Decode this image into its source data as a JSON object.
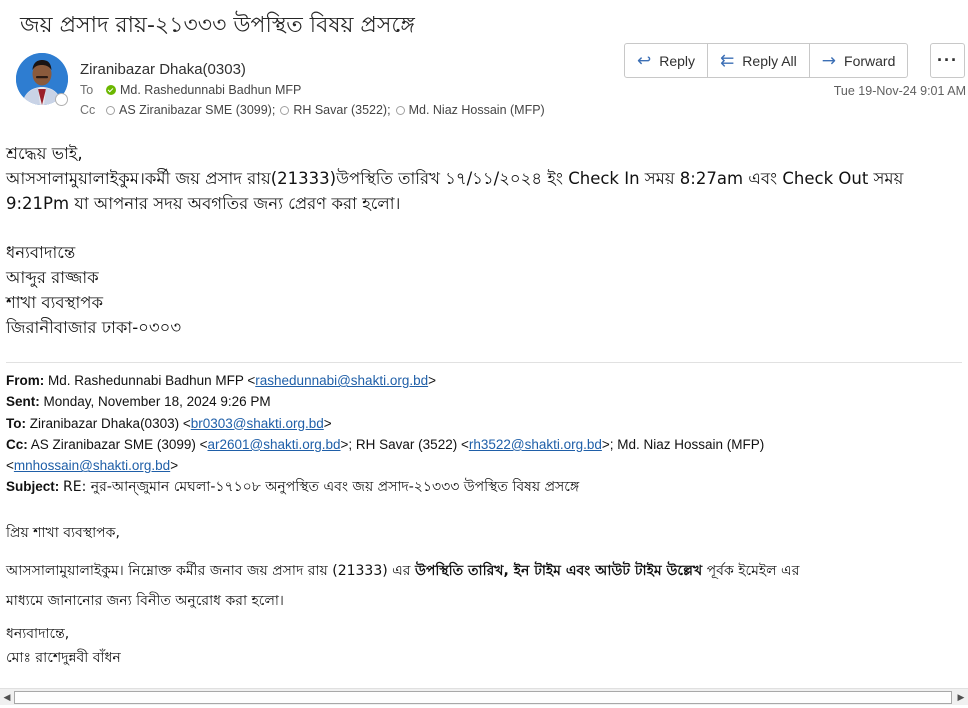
{
  "subject": "জয় প্রসাদ রায়-২১৩৩৩ উপস্থিত বিষয় প্রসঙ্গে",
  "header": {
    "sender": "Ziranibazar Dhaka(0303)",
    "to_label": "To",
    "to": "Md. Rashedunnabi Badhun MFP",
    "cc_label": "Cc",
    "cc": [
      "AS Ziranibazar SME (3099);",
      "RH Savar (3522);",
      "Md. Niaz Hossain (MFP)"
    ],
    "date": "Tue 19-Nov-24 9:01 AM"
  },
  "actions": {
    "reply": "Reply",
    "reply_all": "Reply All",
    "forward": "Forward",
    "more": "···"
  },
  "body": {
    "greeting": "শ্রদ্ধেয় ভাই,",
    "line1": "আসসালামুয়ালাইকুম।কর্মী জয় প্রসাদ রায়(21333)উপস্থিতি তারিখ ১৭/১১/২০২৪ ইং  Check In সময় 8:27am এবং Check Out সময়",
    "line2": "9:21Pm যা আপনার সদয় অবগতির জন্য প্রেরণ করা হলো।",
    "closing": "ধন্যবাদান্তে",
    "name": "আব্দুর রাজ্জাক",
    "title": "শাখা ব্যবস্থাপক",
    "branch": "জিরানীবাজার ঢাকা-০৩০৩"
  },
  "quoted": {
    "from_label": "From:",
    "from_name": "Md. Rashedunnabi Badhun MFP <",
    "from_email": "rashedunnabi@shakti.org.bd",
    "from_end": ">",
    "sent_label": "Sent:",
    "sent": "Monday, November 18, 2024 9:26 PM",
    "to_label": "To:",
    "to_name": "Ziranibazar Dhaka(0303) <",
    "to_email": "br0303@shakti.org.bd",
    "to_end": ">",
    "cc_label": "Cc:",
    "cc_name1": "AS Ziranibazar SME (3099) <",
    "cc_email1": "ar2601@shakti.org.bd",
    "cc_name2": ">; RH Savar (3522) <",
    "cc_email2": "rh3522@shakti.org.bd",
    "cc_name3": ">; Md. Niaz Hossain (MFP)",
    "cc_open": "<",
    "cc_email3": "mnhossain@shakti.org.bd",
    "cc_end": ">",
    "subject_label": "Subject:",
    "subject": "RE: নুর-আন্জুমান মেঘলা-১৭১০৮ অনুপস্থিত এবং জয় প্রসাদ-২১৩৩৩ উপস্থিত বিষয় প্রসঙ্গে"
  },
  "quoted_body": {
    "greeting": "প্রিয় শাখা ব্যবস্থাপক,",
    "line1_start": "আসসালামুয়ালাইকুম। নিম্নোক্ত কর্মীর জনাব জয় প্রসাদ রায় (21333) এর ",
    "line1_bold": "উপস্থিতি তারিখ, ইন টাইম এবং আউট টাইম উল্লেখ",
    "line1_end": " পূর্বক ইমেইল এর",
    "line2": "মাধ্যমে জানানোর জন্য বিনীত অনুরোধ করা হলো।",
    "closing": "ধন্যবাদান্তে,",
    "name": "মোঃ রাশেদুন্নবী বাঁধন"
  }
}
